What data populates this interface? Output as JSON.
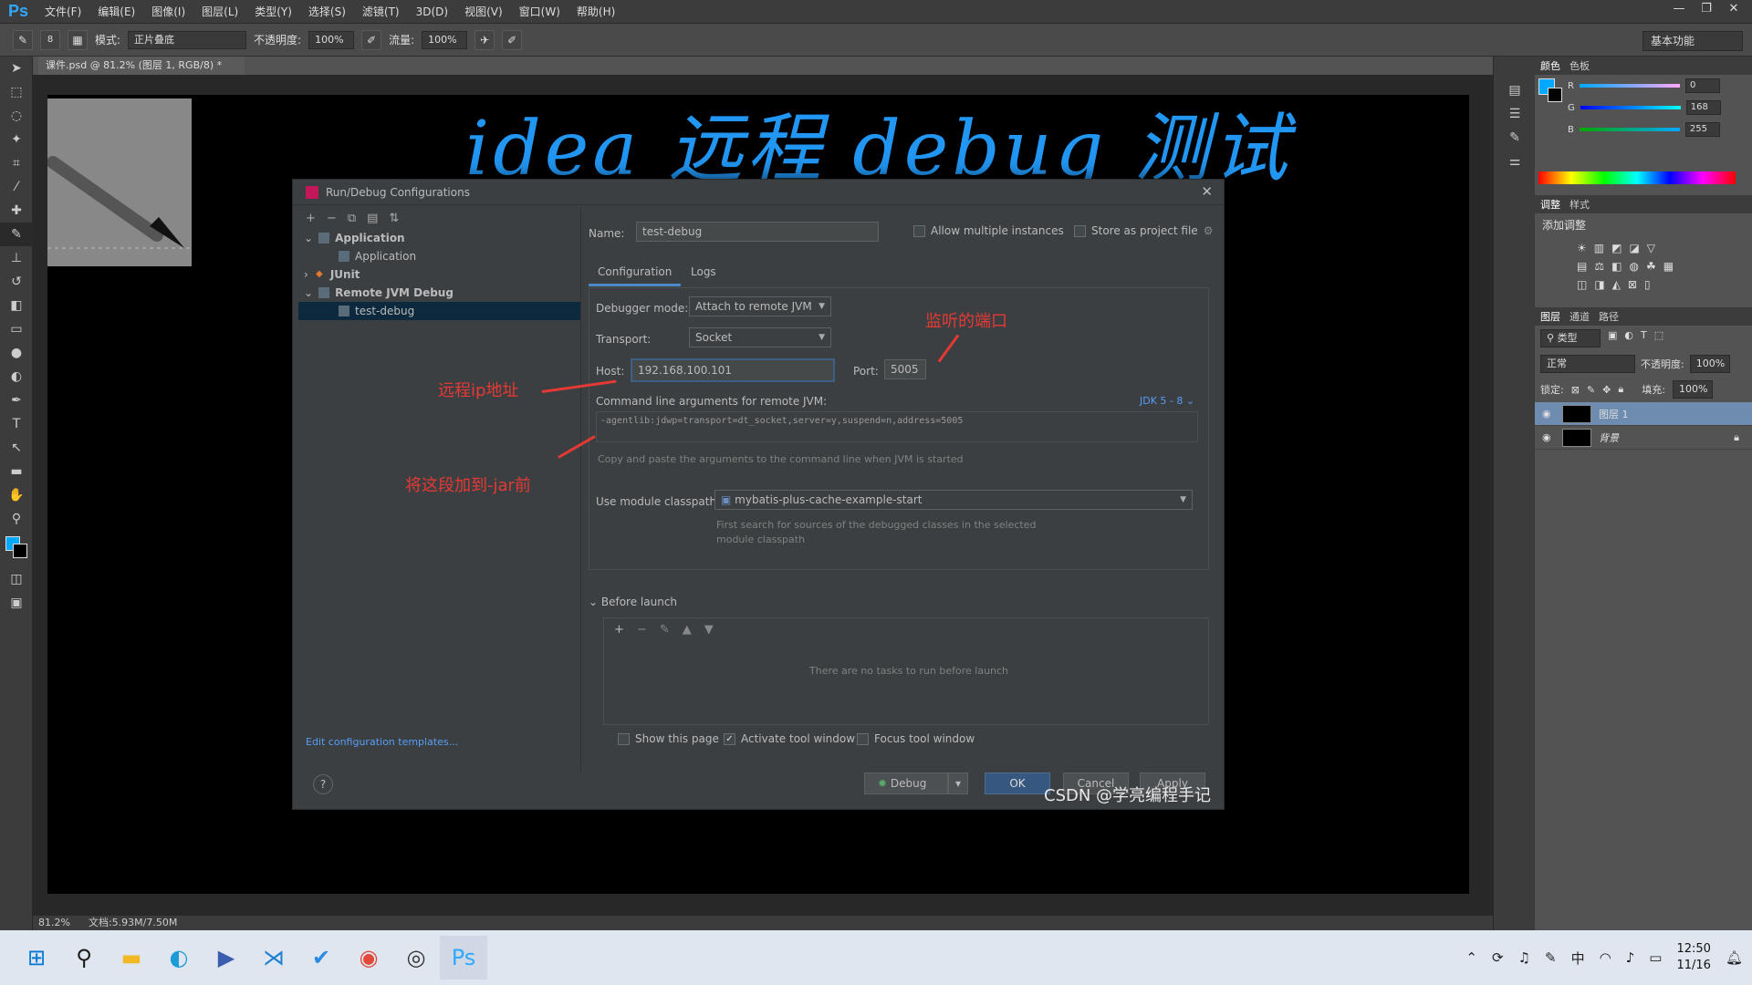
{
  "app": {
    "logo": "Ps",
    "menu": [
      "文件(F)",
      "编辑(E)",
      "图像(I)",
      "图层(L)",
      "类型(Y)",
      "选择(S)",
      "滤镜(T)",
      "3D(D)",
      "视图(V)",
      "窗口(W)",
      "帮助(H)"
    ],
    "window_controls": [
      "—",
      "❐",
      "✕"
    ]
  },
  "options_bar": {
    "brush_size": "8",
    "mode_label": "模式:",
    "mode_value": "正片叠底",
    "opacity_label": "不透明度:",
    "opacity_value": "100%",
    "flow_label": "流量:",
    "flow_value": "100%",
    "workspace": "基本功能"
  },
  "document": {
    "tab_title": "课件.psd @ 81.2% (图层 1, RGB/8) *",
    "headline": "idea 远程 debug 测试",
    "zoom": "81.2%",
    "doc_size": "文档:5.93M/7.50M"
  },
  "dialog": {
    "title": "Run/Debug Configurations",
    "tree": [
      {
        "label": "Application",
        "level": 0,
        "expanded": true,
        "bold": true
      },
      {
        "label": "Application",
        "level": 1
      },
      {
        "label": "JUnit",
        "level": 0,
        "expanded": false,
        "bold": true
      },
      {
        "label": "Remote JVM Debug",
        "level": 0,
        "expanded": true,
        "bold": true
      },
      {
        "label": "test-debug",
        "level": 1,
        "selected": true
      }
    ],
    "name_label": "Name:",
    "name_value": "test-debug",
    "allow_multiple": "Allow multiple instances",
    "store_project": "Store as project file",
    "tabs": [
      "Configuration",
      "Logs"
    ],
    "debugger_mode_label": "Debugger mode:",
    "debugger_mode_value": "Attach to remote JVM",
    "transport_label": "Transport:",
    "transport_value": "Socket",
    "host_label": "Host:",
    "host_value": "192.168.100.101",
    "port_label": "Port:",
    "port_value": "5005",
    "cmd_label": "Command line arguments for remote JVM:",
    "jdk_link": "JDK 5 - 8",
    "cmd_value": "-agentlib:jdwp=transport=dt_socket,server=y,suspend=n,address=5005",
    "cmd_hint": "Copy and paste the arguments to the command line when JVM is started",
    "module_label": "Use module classpath:",
    "module_value": "mybatis-plus-cache-example-start",
    "module_hint_1": "First search for sources of the debugged classes in the selected",
    "module_hint_2": "module classpath",
    "before_launch": "Before launch",
    "before_empty": "There are no tasks to run before launch",
    "show_page": "Show this page",
    "activate_tool": "Activate tool window",
    "focus_tool": "Focus tool window",
    "edit_templates": "Edit configuration templates...",
    "help": "?",
    "debug_btn": "Debug",
    "ok_btn": "OK",
    "cancel_btn": "Cancel",
    "apply_btn": "Apply"
  },
  "annotations": {
    "port": "监听的端口",
    "ip": "远程ip地址",
    "jar": "将这段加到-jar前"
  },
  "watermark": "CSDN @学亮编程手记",
  "panels": {
    "color_tabs": [
      "颜色",
      "色板"
    ],
    "r": "0",
    "g": "168",
    "b": "255",
    "adjust_tabs": [
      "调整",
      "样式"
    ],
    "adjust_title": "添加调整",
    "layer_tabs": [
      "图层",
      "通道",
      "路径"
    ],
    "kind": "类型",
    "blend": "正常",
    "opacity_label": "不透明度:",
    "opacity": "100%",
    "lock_label": "锁定:",
    "fill_label": "填充:",
    "fill": "100%",
    "layers": [
      "图层 1",
      "背景"
    ]
  },
  "taskbar": {
    "ime": "中",
    "time": "12:50",
    "date": "11/16"
  },
  "colors": {
    "accent": "#2196f3",
    "annotation": "#e53935",
    "foreground_swatch": "#00a8ff"
  }
}
